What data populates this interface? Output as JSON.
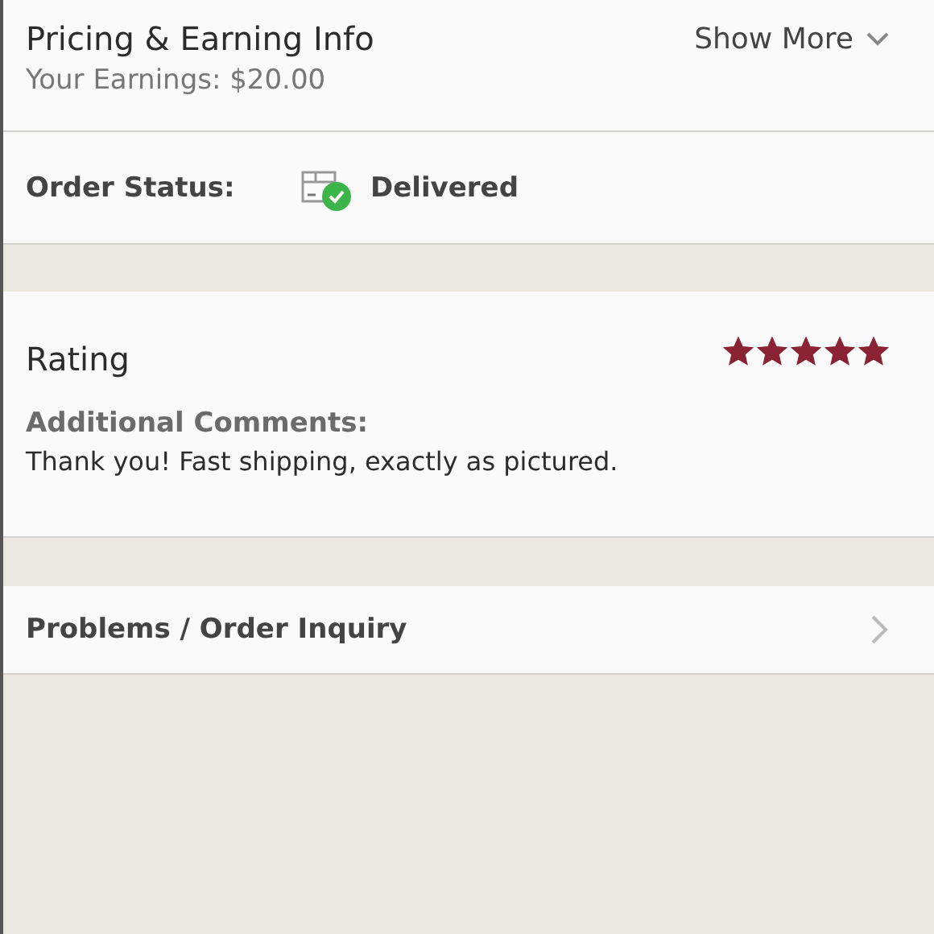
{
  "pricing": {
    "title": "Pricing & Earning Info",
    "earnings": "Your Earnings: $20.00",
    "toggle": "Show More",
    "expanded": false
  },
  "order_status": {
    "label": "Order Status:",
    "value": "Delivered",
    "kind": "delivered"
  },
  "rating": {
    "title": "Rating",
    "stars": 5,
    "comments_label": "Additional Comments:",
    "comment": "Thank you! Fast shipping, exactly as pictured."
  },
  "inquiry": {
    "label": "Problems / Order Inquiry"
  }
}
